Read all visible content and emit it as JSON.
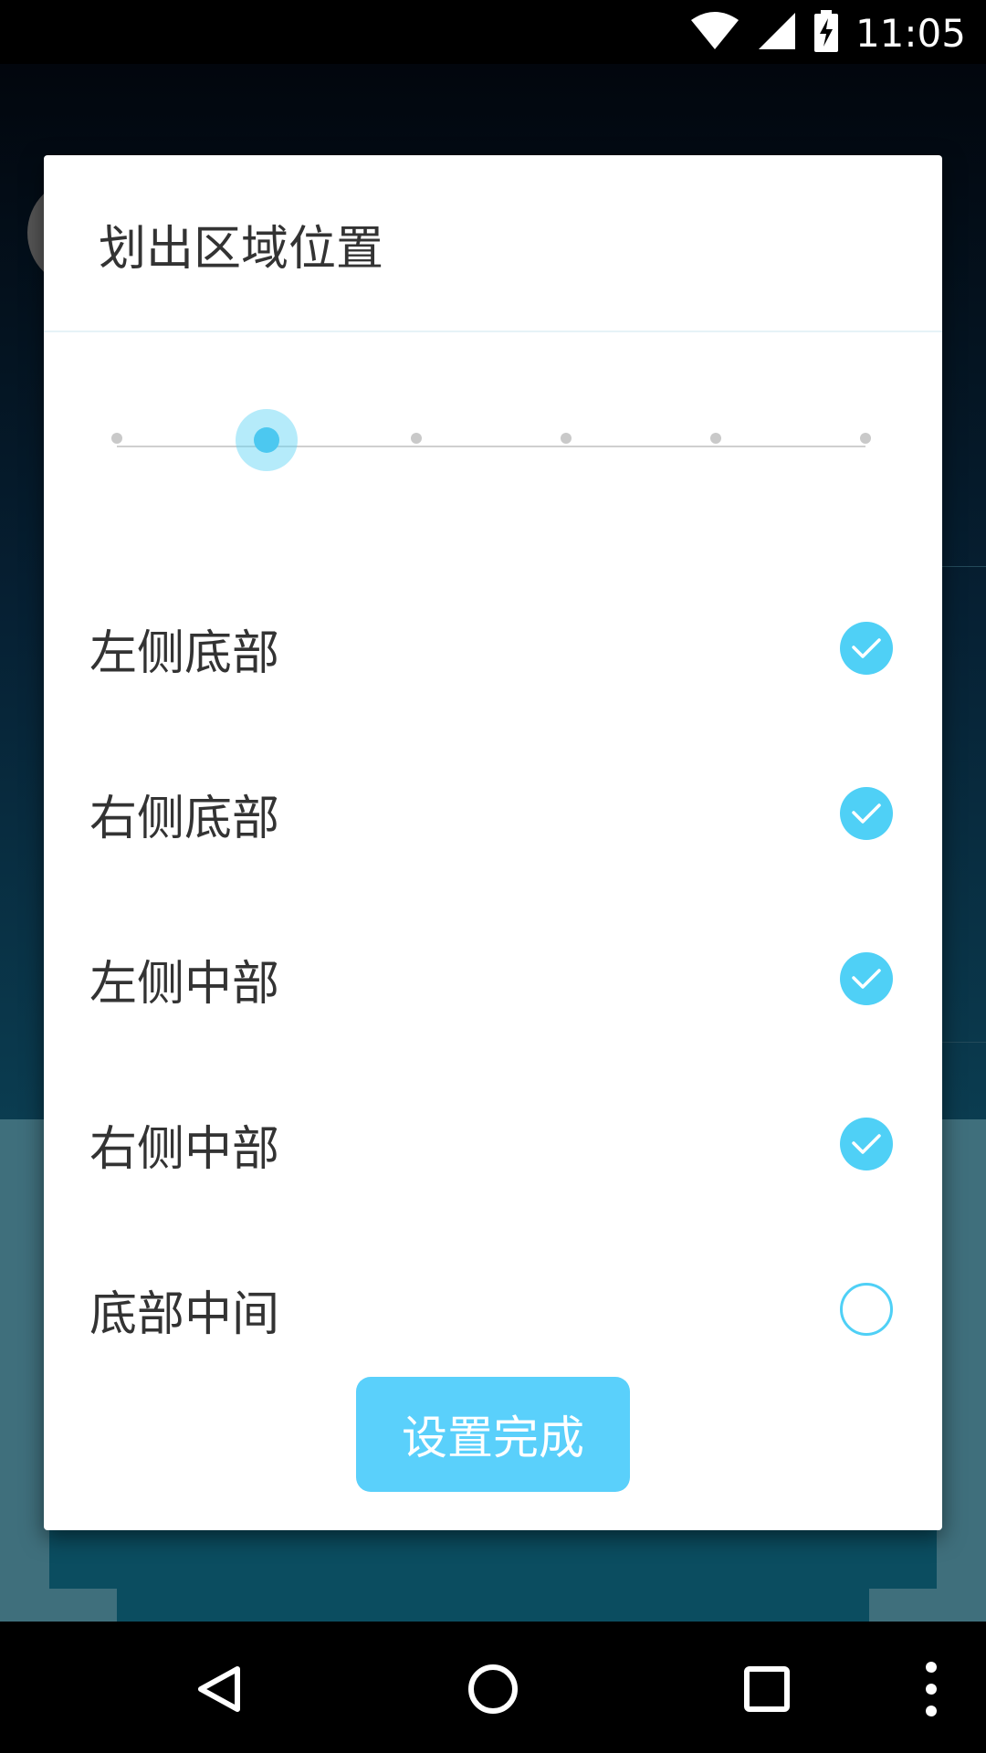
{
  "status_bar": {
    "time": "11:05",
    "icons": [
      "wifi-icon",
      "cell-signal-icon",
      "battery-charging-icon"
    ]
  },
  "dialog": {
    "title": "划出区域位置",
    "slider": {
      "steps": 6,
      "selected_index": 1
    },
    "options": [
      {
        "label": "左侧底部",
        "checked": true
      },
      {
        "label": "右侧底部",
        "checked": true
      },
      {
        "label": "左侧中部",
        "checked": true
      },
      {
        "label": "右侧中部",
        "checked": true
      },
      {
        "label": "底部中间",
        "checked": false
      }
    ],
    "done_label": "设置完成"
  },
  "nav_bar": {
    "buttons": [
      "back-icon",
      "home-icon",
      "recents-icon",
      "overflow-menu-icon"
    ]
  },
  "colors": {
    "accent": "#4fd0f6",
    "button": "#5ad0fb",
    "text": "#333333"
  }
}
